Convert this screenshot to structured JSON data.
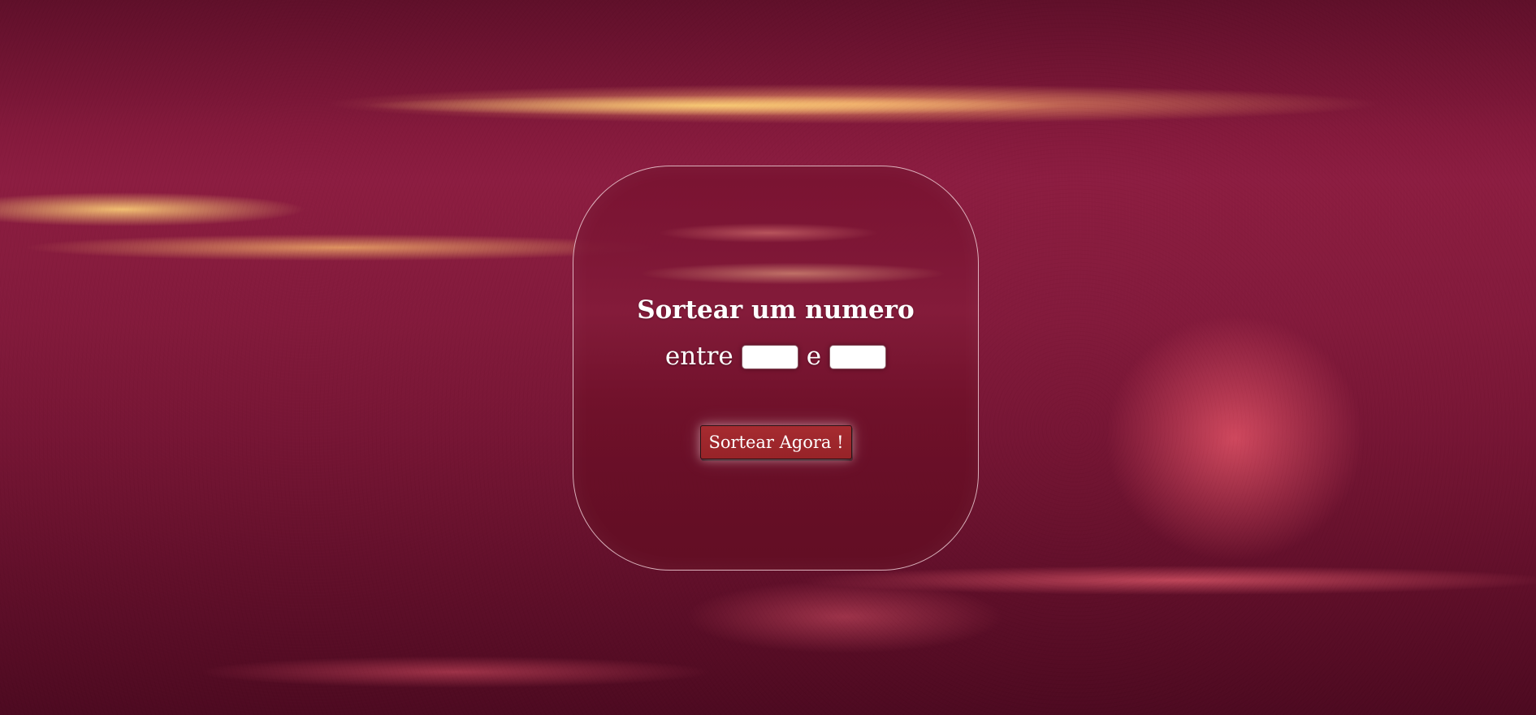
{
  "app": {
    "title": "Sortear um numero",
    "range_prefix": "entre",
    "range_connector": "e",
    "button_label": "Sortear Agora !",
    "inputs": {
      "min_value": "",
      "max_value": ""
    }
  },
  "colors": {
    "button_bg": "#a62b30",
    "card_border": "#ffe6eb",
    "text": "#ffffff"
  }
}
